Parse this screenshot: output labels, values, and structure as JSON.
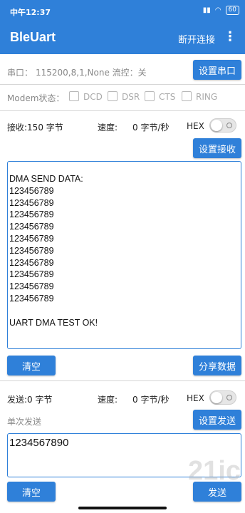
{
  "statusbar": {
    "time": "中午12:37",
    "battery": "60"
  },
  "appbar": {
    "title": "BleUart",
    "disconnect": "断开连接",
    "menu": "⋮"
  },
  "serial": {
    "label": "串口：",
    "value": "115200,8,1,None 流控：关",
    "button": "设置串口"
  },
  "modem": {
    "label": "Modem状态：",
    "signals": [
      "DCD",
      "DSR",
      "CTS",
      "RING"
    ]
  },
  "receive": {
    "label": "接收:150 字节",
    "speed_label": "速度:",
    "speed_value": "0 字节/秒",
    "hex_label": "HEX",
    "setup_button": "设置接收",
    "lines": [
      "DMA SEND DATA:",
      "123456789",
      "123456789",
      "123456789",
      "123456789",
      "123456789",
      "123456789",
      "123456789",
      "123456789",
      "123456789",
      "123456789",
      "",
      "UART DMA TEST OK!"
    ],
    "clear_button": "清空",
    "share_button": "分享数据"
  },
  "send": {
    "label": "发送:0 字节",
    "speed_label": "速度:",
    "speed_value": "0 字节/秒",
    "hex_label": "HEX",
    "mode_label": "单次发送",
    "setup_button": "设置发送",
    "input_value": "1234567890",
    "clear_button": "清空",
    "send_button": "发送"
  },
  "watermark": "21ic"
}
